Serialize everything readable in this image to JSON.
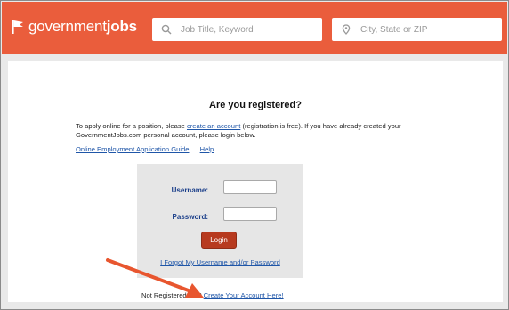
{
  "brand": {
    "name_regular": "government",
    "name_bold": "jobs"
  },
  "search": {
    "keyword_placeholder": "Job Title, Keyword",
    "location_placeholder": "City, State or ZIP"
  },
  "page": {
    "title": "Are you registered?",
    "intro_before": "To apply online for a position, please ",
    "intro_link": "create an account",
    "intro_after": " (registration is free). If you have already created your GovernmentJobs.com personal account, please login below.",
    "guide_link": "Online Employment Application Guide",
    "help_link": "Help"
  },
  "login": {
    "username_label": "Username:",
    "password_label": "Password:",
    "login_button": "Login",
    "forgot_link": "I Forgot My Username and/or Password"
  },
  "footer": {
    "not_registered": "Not Registered Yet?",
    "create_link": "Create Your Account Here!"
  },
  "colors": {
    "header": "#ea5d3c",
    "link": "#1f56a8",
    "button": "#b73a1f",
    "arrow": "#e8562f"
  },
  "icons": [
    "flag-icon",
    "search-icon",
    "location-pin-icon"
  ]
}
